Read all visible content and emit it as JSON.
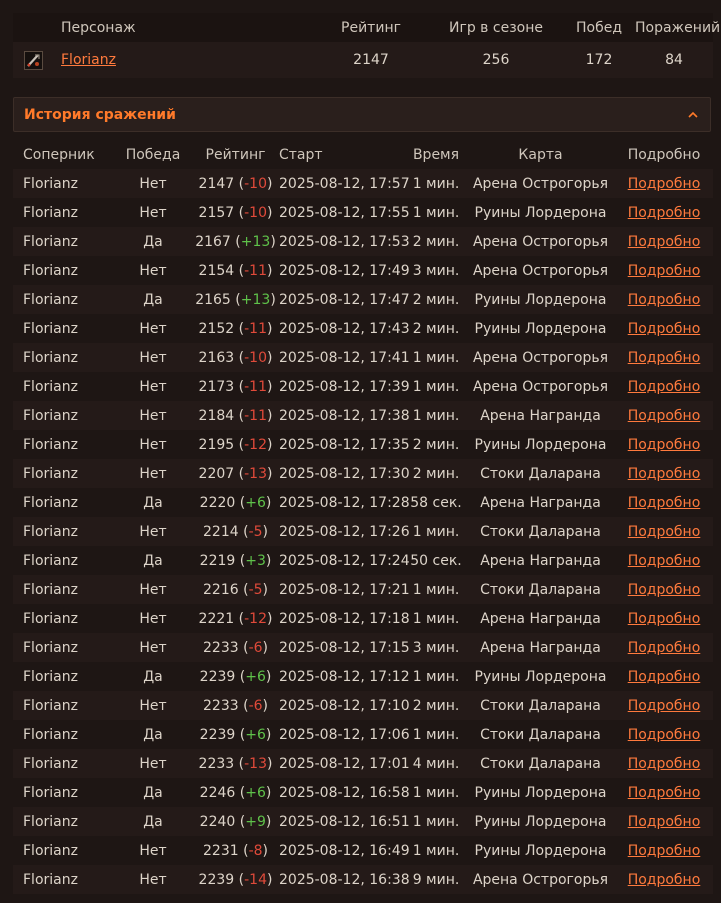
{
  "character_table": {
    "headers": {
      "character": "Персонаж",
      "rating": "Рейтинг",
      "games": "Игр в сезоне",
      "wins": "Побед",
      "losses": "Поражений"
    },
    "row": {
      "name": "Florianz",
      "rating": "2147",
      "games": "256",
      "wins": "172",
      "losses": "84"
    }
  },
  "history": {
    "title": "История сражений",
    "headers": {
      "opponent": "Соперник",
      "win": "Победа",
      "rating": "Рейтинг",
      "start": "Старт",
      "time": "Время",
      "map": "Карта",
      "details": "Подробно"
    },
    "rows": [
      {
        "opponent": "Florianz",
        "win": "Нет",
        "rating": "2147",
        "change": "-10",
        "start": "2025-08-12, 17:57",
        "time": "1 мин.",
        "map": "Арена Острогорья",
        "details": "Подробно"
      },
      {
        "opponent": "Florianz",
        "win": "Нет",
        "rating": "2157",
        "change": "-10",
        "start": "2025-08-12, 17:55",
        "time": "1 мин.",
        "map": "Руины Лордерона",
        "details": "Подробно"
      },
      {
        "opponent": "Florianz",
        "win": "Да",
        "rating": "2167",
        "change": "+13",
        "start": "2025-08-12, 17:53",
        "time": "2 мин.",
        "map": "Арена Острогорья",
        "details": "Подробно"
      },
      {
        "opponent": "Florianz",
        "win": "Нет",
        "rating": "2154",
        "change": "-11",
        "start": "2025-08-12, 17:49",
        "time": "3 мин.",
        "map": "Арена Острогорья",
        "details": "Подробно"
      },
      {
        "opponent": "Florianz",
        "win": "Да",
        "rating": "2165",
        "change": "+13",
        "start": "2025-08-12, 17:47",
        "time": "2 мин.",
        "map": "Руины Лордерона",
        "details": "Подробно"
      },
      {
        "opponent": "Florianz",
        "win": "Нет",
        "rating": "2152",
        "change": "-11",
        "start": "2025-08-12, 17:43",
        "time": "2 мин.",
        "map": "Руины Лордерона",
        "details": "Подробно"
      },
      {
        "opponent": "Florianz",
        "win": "Нет",
        "rating": "2163",
        "change": "-10",
        "start": "2025-08-12, 17:41",
        "time": "1 мин.",
        "map": "Арена Острогорья",
        "details": "Подробно"
      },
      {
        "opponent": "Florianz",
        "win": "Нет",
        "rating": "2173",
        "change": "-11",
        "start": "2025-08-12, 17:39",
        "time": "1 мин.",
        "map": "Арена Острогорья",
        "details": "Подробно"
      },
      {
        "opponent": "Florianz",
        "win": "Нет",
        "rating": "2184",
        "change": "-11",
        "start": "2025-08-12, 17:38",
        "time": "1 мин.",
        "map": "Арена Награнда",
        "details": "Подробно"
      },
      {
        "opponent": "Florianz",
        "win": "Нет",
        "rating": "2195",
        "change": "-12",
        "start": "2025-08-12, 17:35",
        "time": "2 мин.",
        "map": "Руины Лордерона",
        "details": "Подробно"
      },
      {
        "opponent": "Florianz",
        "win": "Нет",
        "rating": "2207",
        "change": "-13",
        "start": "2025-08-12, 17:30",
        "time": "2 мин.",
        "map": "Стоки Даларана",
        "details": "Подробно"
      },
      {
        "opponent": "Florianz",
        "win": "Да",
        "rating": "2220",
        "change": "+6",
        "start": "2025-08-12, 17:28",
        "time": "58 сек.",
        "map": "Арена Награнда",
        "details": "Подробно"
      },
      {
        "opponent": "Florianz",
        "win": "Нет",
        "rating": "2214",
        "change": "-5",
        "start": "2025-08-12, 17:26",
        "time": "1 мин.",
        "map": "Стоки Даларана",
        "details": "Подробно"
      },
      {
        "opponent": "Florianz",
        "win": "Да",
        "rating": "2219",
        "change": "+3",
        "start": "2025-08-12, 17:24",
        "time": "50 сек.",
        "map": "Арена Награнда",
        "details": "Подробно"
      },
      {
        "opponent": "Florianz",
        "win": "Нет",
        "rating": "2216",
        "change": "-5",
        "start": "2025-08-12, 17:21",
        "time": "1 мин.",
        "map": "Стоки Даларана",
        "details": "Подробно"
      },
      {
        "opponent": "Florianz",
        "win": "Нет",
        "rating": "2221",
        "change": "-12",
        "start": "2025-08-12, 17:18",
        "time": "1 мин.",
        "map": "Арена Награнда",
        "details": "Подробно"
      },
      {
        "opponent": "Florianz",
        "win": "Нет",
        "rating": "2233",
        "change": "-6",
        "start": "2025-08-12, 17:15",
        "time": "3 мин.",
        "map": "Арена Награнда",
        "details": "Подробно"
      },
      {
        "opponent": "Florianz",
        "win": "Да",
        "rating": "2239",
        "change": "+6",
        "start": "2025-08-12, 17:12",
        "time": "1 мин.",
        "map": "Руины Лордерона",
        "details": "Подробно"
      },
      {
        "opponent": "Florianz",
        "win": "Нет",
        "rating": "2233",
        "change": "-6",
        "start": "2025-08-12, 17:10",
        "time": "2 мин.",
        "map": "Стоки Даларана",
        "details": "Подробно"
      },
      {
        "opponent": "Florianz",
        "win": "Да",
        "rating": "2239",
        "change": "+6",
        "start": "2025-08-12, 17:06",
        "time": "1 мин.",
        "map": "Стоки Даларана",
        "details": "Подробно"
      },
      {
        "opponent": "Florianz",
        "win": "Нет",
        "rating": "2233",
        "change": "-13",
        "start": "2025-08-12, 17:01",
        "time": "4 мин.",
        "map": "Стоки Даларана",
        "details": "Подробно"
      },
      {
        "opponent": "Florianz",
        "win": "Да",
        "rating": "2246",
        "change": "+6",
        "start": "2025-08-12, 16:58",
        "time": "1 мин.",
        "map": "Руины Лордерона",
        "details": "Подробно"
      },
      {
        "opponent": "Florianz",
        "win": "Да",
        "rating": "2240",
        "change": "+9",
        "start": "2025-08-12, 16:51",
        "time": "1 мин.",
        "map": "Руины Лордерона",
        "details": "Подробно"
      },
      {
        "opponent": "Florianz",
        "win": "Нет",
        "rating": "2231",
        "change": "-8",
        "start": "2025-08-12, 16:49",
        "time": "1 мин.",
        "map": "Руины Лордерона",
        "details": "Подробно"
      },
      {
        "opponent": "Florianz",
        "win": "Нет",
        "rating": "2239",
        "change": "-14",
        "start": "2025-08-12, 16:38",
        "time": "9 мин.",
        "map": "Арена Острогорья",
        "details": "Подробно"
      }
    ]
  },
  "colors": {
    "accent": "#ff7a2a",
    "link": "#ff7a3d",
    "negative": "#e04a3a",
    "positive": "#5fc24a"
  },
  "icons": {
    "avatar": "class-portrait-icon",
    "collapse": "chevron-up-icon"
  }
}
